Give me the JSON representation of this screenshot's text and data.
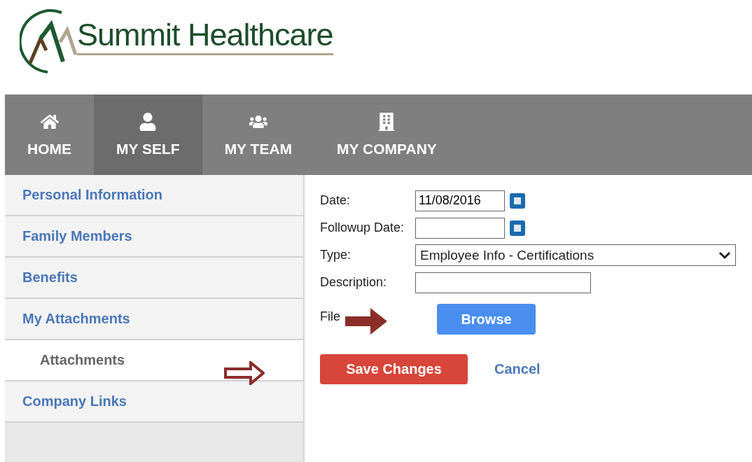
{
  "logo": {
    "name": "Summit Healthcare"
  },
  "nav": [
    {
      "label": "HOME",
      "selected": false
    },
    {
      "label": "MY SELF",
      "selected": true
    },
    {
      "label": "MY TEAM",
      "selected": false
    },
    {
      "label": "MY COMPANY",
      "selected": false
    }
  ],
  "sidebar": {
    "items": [
      {
        "label": "Personal Information",
        "selected": false
      },
      {
        "label": "Family Members",
        "selected": false
      },
      {
        "label": "Benefits",
        "selected": false
      },
      {
        "label": "My Attachments",
        "selected": false,
        "children": [
          {
            "label": "Attachments",
            "selected": true
          }
        ]
      },
      {
        "label": "Company Links",
        "selected": false
      }
    ]
  },
  "form": {
    "fields": [
      {
        "kind": "date",
        "label": "Date:",
        "value": "11/08/2016"
      },
      {
        "kind": "date",
        "label": "Followup Date:"
      },
      {
        "kind": "select",
        "label": "Type:",
        "value": "Employee Info - Certifications"
      },
      {
        "kind": "text",
        "label": "Description:"
      },
      {
        "kind": "file",
        "label": "File",
        "button": "Browse"
      }
    ],
    "save": "Save Changes",
    "cancel": "Cancel"
  }
}
